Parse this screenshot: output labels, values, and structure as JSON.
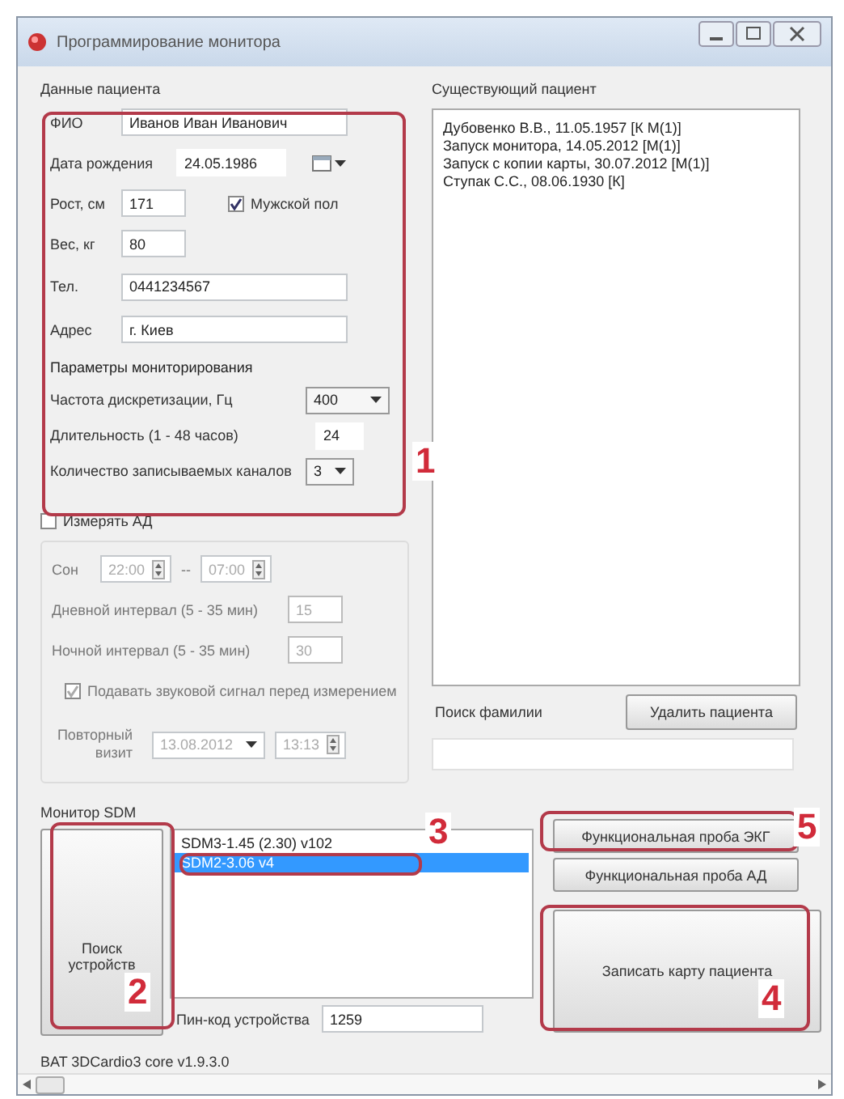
{
  "window": {
    "title": "Программирование монитора"
  },
  "patient": {
    "title": "Данные пациента",
    "fio": {
      "label": "ФИО",
      "value": "Иванов Иван Иванович"
    },
    "birth": {
      "label": "Дата рождения",
      "value": "24.05.1986"
    },
    "height": {
      "label": "Рост, см",
      "value": "171"
    },
    "male": {
      "label": "Мужской пол",
      "checked": true
    },
    "weight": {
      "label": "Вес, кг",
      "value": "80"
    },
    "phone": {
      "label": "Тел.",
      "value": "0441234567"
    },
    "address": {
      "label": "Адрес",
      "value": "г. Киев"
    }
  },
  "monitoring": {
    "title": "Параметры мониторирования",
    "frequency": {
      "label": "Частота дискретизации, Гц",
      "value": "400"
    },
    "duration": {
      "label": "Длительность (1 - 48 часов)",
      "value": "24"
    },
    "channels": {
      "label": "Количество записываемых каналов",
      "value": "3"
    }
  },
  "blood_pressure": {
    "label": "Измерять АД",
    "checked": false,
    "sleep": {
      "label": "Сон",
      "from": "22:00",
      "separator": "--",
      "to": "07:00"
    },
    "day_interval": {
      "label": "Дневной интервал (5 - 35 мин)",
      "value": "15"
    },
    "night_interval": {
      "label": "Ночной интервал (5 - 35 мин)",
      "value": "30"
    },
    "beep": {
      "label": "Подавать звуковой сигнал перед измерением",
      "checked": true
    }
  },
  "revisit": {
    "label": "Повторный визит",
    "date": "13.08.2012",
    "time": "13:13"
  },
  "existing": {
    "title": "Существующий пациент",
    "items": [
      {
        "text": "Дубовенко В.В., 11.05.1957 [К М(1)]"
      },
      {
        "text": "Запуск монитора, 14.05.2012 [М(1)]"
      },
      {
        "text": "Запуск с копии карты, 30.07.2012 [М(1)]"
      },
      {
        "text": "Ступак С.С., 08.06.1930 [К]"
      }
    ],
    "search_label": "Поиск фамилии",
    "delete_button": "Удалить пациента"
  },
  "sdm": {
    "title": "Монитор SDM",
    "search_button": "Поиск устройств",
    "devices": [
      {
        "text": "SDM3-1.45 (2.30) v102",
        "selected": false
      },
      {
        "text": "SDM2-3.06 v4",
        "selected": true
      }
    ],
    "pin": {
      "label": "Пин-код устройства",
      "value": "1259"
    }
  },
  "actions": [
    {
      "label": "Функциональная проба ЭКГ",
      "kind": "small"
    },
    {
      "label": "Функциональная проба АД",
      "kind": "small"
    },
    {
      "label": "Записать карту пациента",
      "kind": "large"
    }
  ],
  "status_bar": "BAT 3DCardio3 core v1.9.3.0",
  "annotations": [
    {
      "label": "1"
    },
    {
      "label": "2"
    },
    {
      "label": "3"
    },
    {
      "label": "4"
    },
    {
      "label": "5"
    }
  ]
}
